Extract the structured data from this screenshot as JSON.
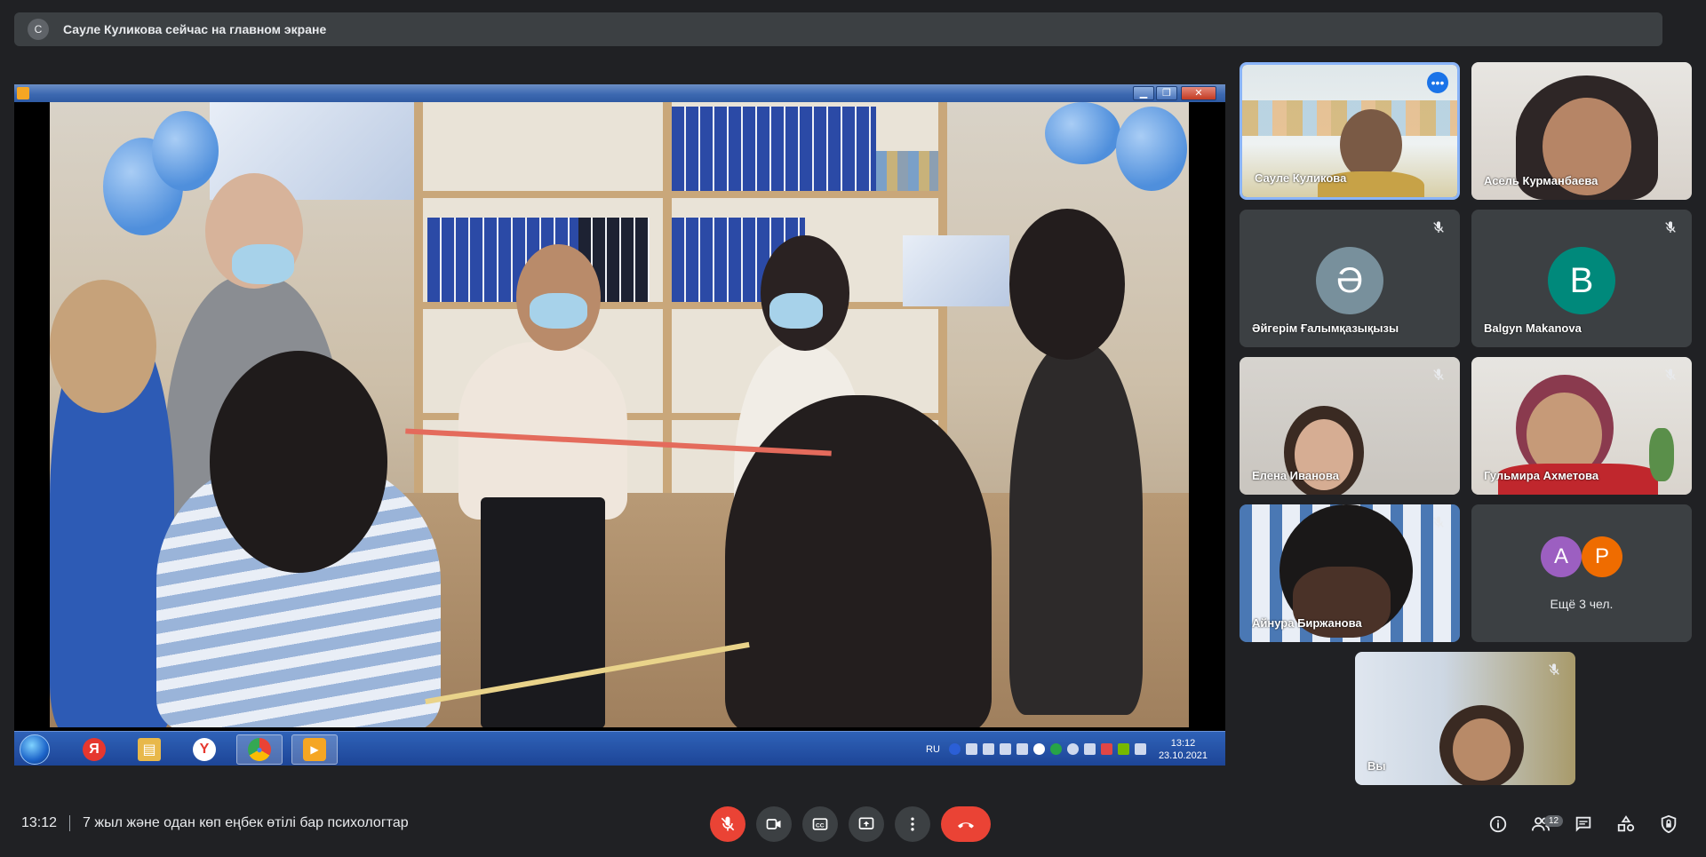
{
  "banner": {
    "avatar_letter": "С",
    "text": "Сауле Куликова сейчас на главном экране"
  },
  "shared_screen": {
    "window_buttons": [
      "▁",
      "❐",
      "✕"
    ],
    "taskbar": {
      "language": "RU",
      "clock_time": "13:12",
      "clock_date": "23.10.2021",
      "apps": [
        {
          "name": "yandex-browser",
          "glyph": "Я",
          "color": "#e6372e"
        },
        {
          "name": "file-explorer",
          "glyph": "▤",
          "color": "#e8b84a"
        },
        {
          "name": "yandex",
          "glyph": "Y",
          "color": "#e6372e"
        },
        {
          "name": "chrome",
          "glyph": "●",
          "color": "#34a853"
        },
        {
          "name": "media-player",
          "glyph": "▶",
          "color": "#f5a623"
        }
      ]
    }
  },
  "participants": [
    {
      "name": "Сауле Куликова",
      "type": "video",
      "active": true
    },
    {
      "name": "Асель Курманбаева",
      "type": "video"
    },
    {
      "name": "Әйгерім Ғалымқазықызы",
      "type": "avatar",
      "letter": "Ә",
      "color": "#78909c",
      "muted": true
    },
    {
      "name": "Balgyn Makanova",
      "type": "avatar",
      "letter": "B",
      "color": "#00897b",
      "muted": true
    },
    {
      "name": "Елена Иванова",
      "type": "video",
      "muted": true
    },
    {
      "name": "Гульмира Ахметова",
      "type": "video",
      "muted": true
    },
    {
      "name": "Айнура Биржанова",
      "type": "video",
      "muted": true
    }
  ],
  "more_tile": {
    "letters": [
      {
        "letter": "A",
        "color": "#9c5fc1"
      },
      {
        "letter": "P",
        "color": "#ef6c00"
      }
    ],
    "label": "Ещё 3 чел."
  },
  "self_tile": {
    "name": "Вы"
  },
  "bottom_bar": {
    "time": "13:12",
    "meeting_title": "7 жыл және одан көп еңбек өтілі бар психологтар",
    "people_count": "12"
  }
}
